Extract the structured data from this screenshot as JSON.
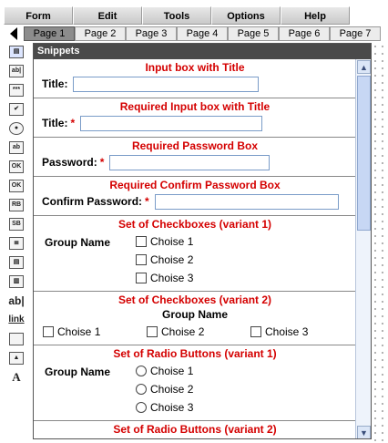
{
  "menu": [
    "Form",
    "Edit",
    "Tools",
    "Options",
    "Help"
  ],
  "tabs": [
    "Page 1",
    "Page 2",
    "Page 3",
    "Page 4",
    "Page 5",
    "Page 6",
    "Page 7"
  ],
  "toolbar": [
    "snippets-tool-icon",
    "text-field-icon",
    "password-field-icon",
    "checkbox-icon",
    "radio-icon",
    "textarea-icon",
    "submit-button-icon",
    "reset-button-icon",
    "reset-button2-icon",
    "submit-button2-icon",
    "list-icon",
    "list2-icon",
    "list3-icon",
    "label-tool-icon",
    "link-tool-icon",
    "box-tool-icon",
    "image-tool-icon",
    "font-tool-icon"
  ],
  "panel": {
    "title": "Snippets",
    "sections": {
      "s1": {
        "title": "Input box with Title",
        "label": "Title:"
      },
      "s2": {
        "title": "Required Input box with Title",
        "label": "Title:",
        "req": "*"
      },
      "s3": {
        "title": "Required Password Box",
        "label": "Password:",
        "req": "*"
      },
      "s4": {
        "title": "Required Confirm Password Box",
        "label": "Confirm Password:",
        "req": "*"
      },
      "s5": {
        "title": "Set of Checkboxes (variant 1)",
        "group": "Group Name",
        "options": [
          "Choise 1",
          "Choise 2",
          "Choise 3"
        ]
      },
      "s6": {
        "title": "Set of Checkboxes (variant 2)",
        "group": "Group Name",
        "options": [
          "Choise 1",
          "Choise 2",
          "Choise 3"
        ]
      },
      "s7": {
        "title": "Set of Radio Buttons (variant 1)",
        "group": "Group Name",
        "options": [
          "Choise 1",
          "Choise 2",
          "Choise 3"
        ]
      },
      "s8": {
        "title": "Set of Radio Buttons (variant 2)"
      }
    }
  },
  "colors": {
    "title_red": "#d40000",
    "header_bg": "#4a4a4a"
  }
}
